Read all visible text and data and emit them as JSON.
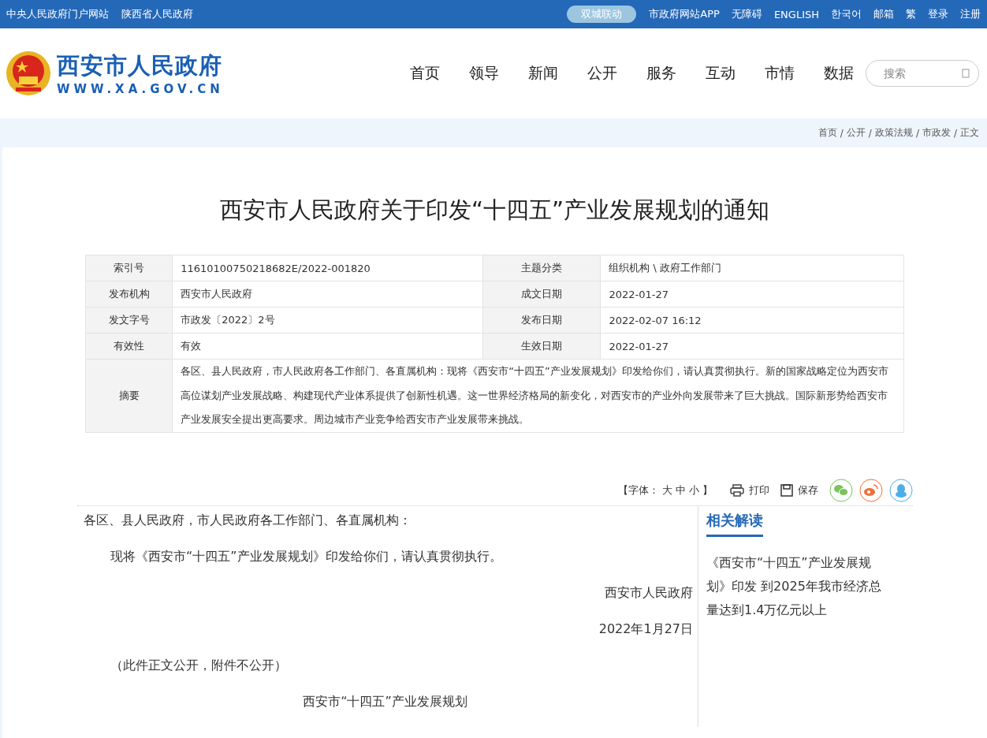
{
  "top_bar": {
    "left_links": [
      "中央人民政府门户网站",
      "陕西省人民政府"
    ],
    "pill": "双城联动",
    "right_links": [
      "市政府网站APP",
      "无障碍",
      "ENGLISH",
      "한국어",
      "邮箱",
      "繁",
      "登录",
      "注册"
    ]
  },
  "header": {
    "site_name": "西安市人民政府",
    "site_url": "WWW.XA.GOV.CN",
    "nav": [
      "首页",
      "领导",
      "新闻",
      "公开",
      "服务",
      "互动",
      "市情",
      "数据"
    ],
    "search": {
      "placeholder": "搜索"
    }
  },
  "breadcrumb": {
    "separator": "/",
    "items": [
      "首页",
      "公开",
      "政策法规",
      "市政发",
      "正文"
    ]
  },
  "article": {
    "title": "西安市人民政府关于印发“十四五”产业发展规划的通知",
    "meta": [
      {
        "label": "索引号",
        "value": "11610100750218682E/2022-001820",
        "label2": "主题分类",
        "value2": "组织机构 \\ 政府工作部门"
      },
      {
        "label": "发布机构",
        "value": "西安市人民政府",
        "label2": "成文日期",
        "value2": "2022-01-27"
      },
      {
        "label": "发文字号",
        "value": "市政发〔2022〕2号",
        "label2": "发布日期",
        "value2": "2022-02-07 16:12"
      },
      {
        "label": "有效性",
        "value": "有效",
        "label2": "生效日期",
        "value2": "2022-01-27"
      }
    ],
    "summary": {
      "label": "摘要",
      "text": "各区、县人民政府，市人民政府各工作部门、各直属机构：现将《西安市“十四五”产业发展规划》印发给你们，请认真贯彻执行。新的国家战略定位为西安市高位谋划产业发展战略、构建现代产业体系提供了创新性机遇。这一世界经济格局的新变化，对西安市的产业外向发展带来了巨大挑战。国际新形势给西安市产业发展安全提出更高要求。周边城市产业竞争给西安市产业发展带来挑战。"
    },
    "tools": {
      "font_open": "【字体：",
      "font_sizes": [
        "大",
        "中",
        "小"
      ],
      "font_close": "】",
      "print": "打印",
      "save": "保存"
    },
    "body": [
      {
        "kind": "left",
        "text": "各区、县人民政府，市人民政府各工作部门、各直属机构："
      },
      {
        "kind": "indent",
        "text": "现将《西安市“十四五”产业发展规划》印发给你们，请认真贯彻执行。"
      },
      {
        "kind": "right",
        "text": "西安市人民政府"
      },
      {
        "kind": "right",
        "text": "2022年1月27日"
      },
      {
        "kind": "indent",
        "text": "（此件正文公开，附件不公开）"
      },
      {
        "kind": "center",
        "text": "西安市“十四五”产业发展规划"
      }
    ]
  },
  "related": {
    "title": "相关解读",
    "items": [
      "《西安市“十四五”产业发展规划》印发 到2025年我市经济总量达到1.4万亿元以上"
    ]
  }
}
